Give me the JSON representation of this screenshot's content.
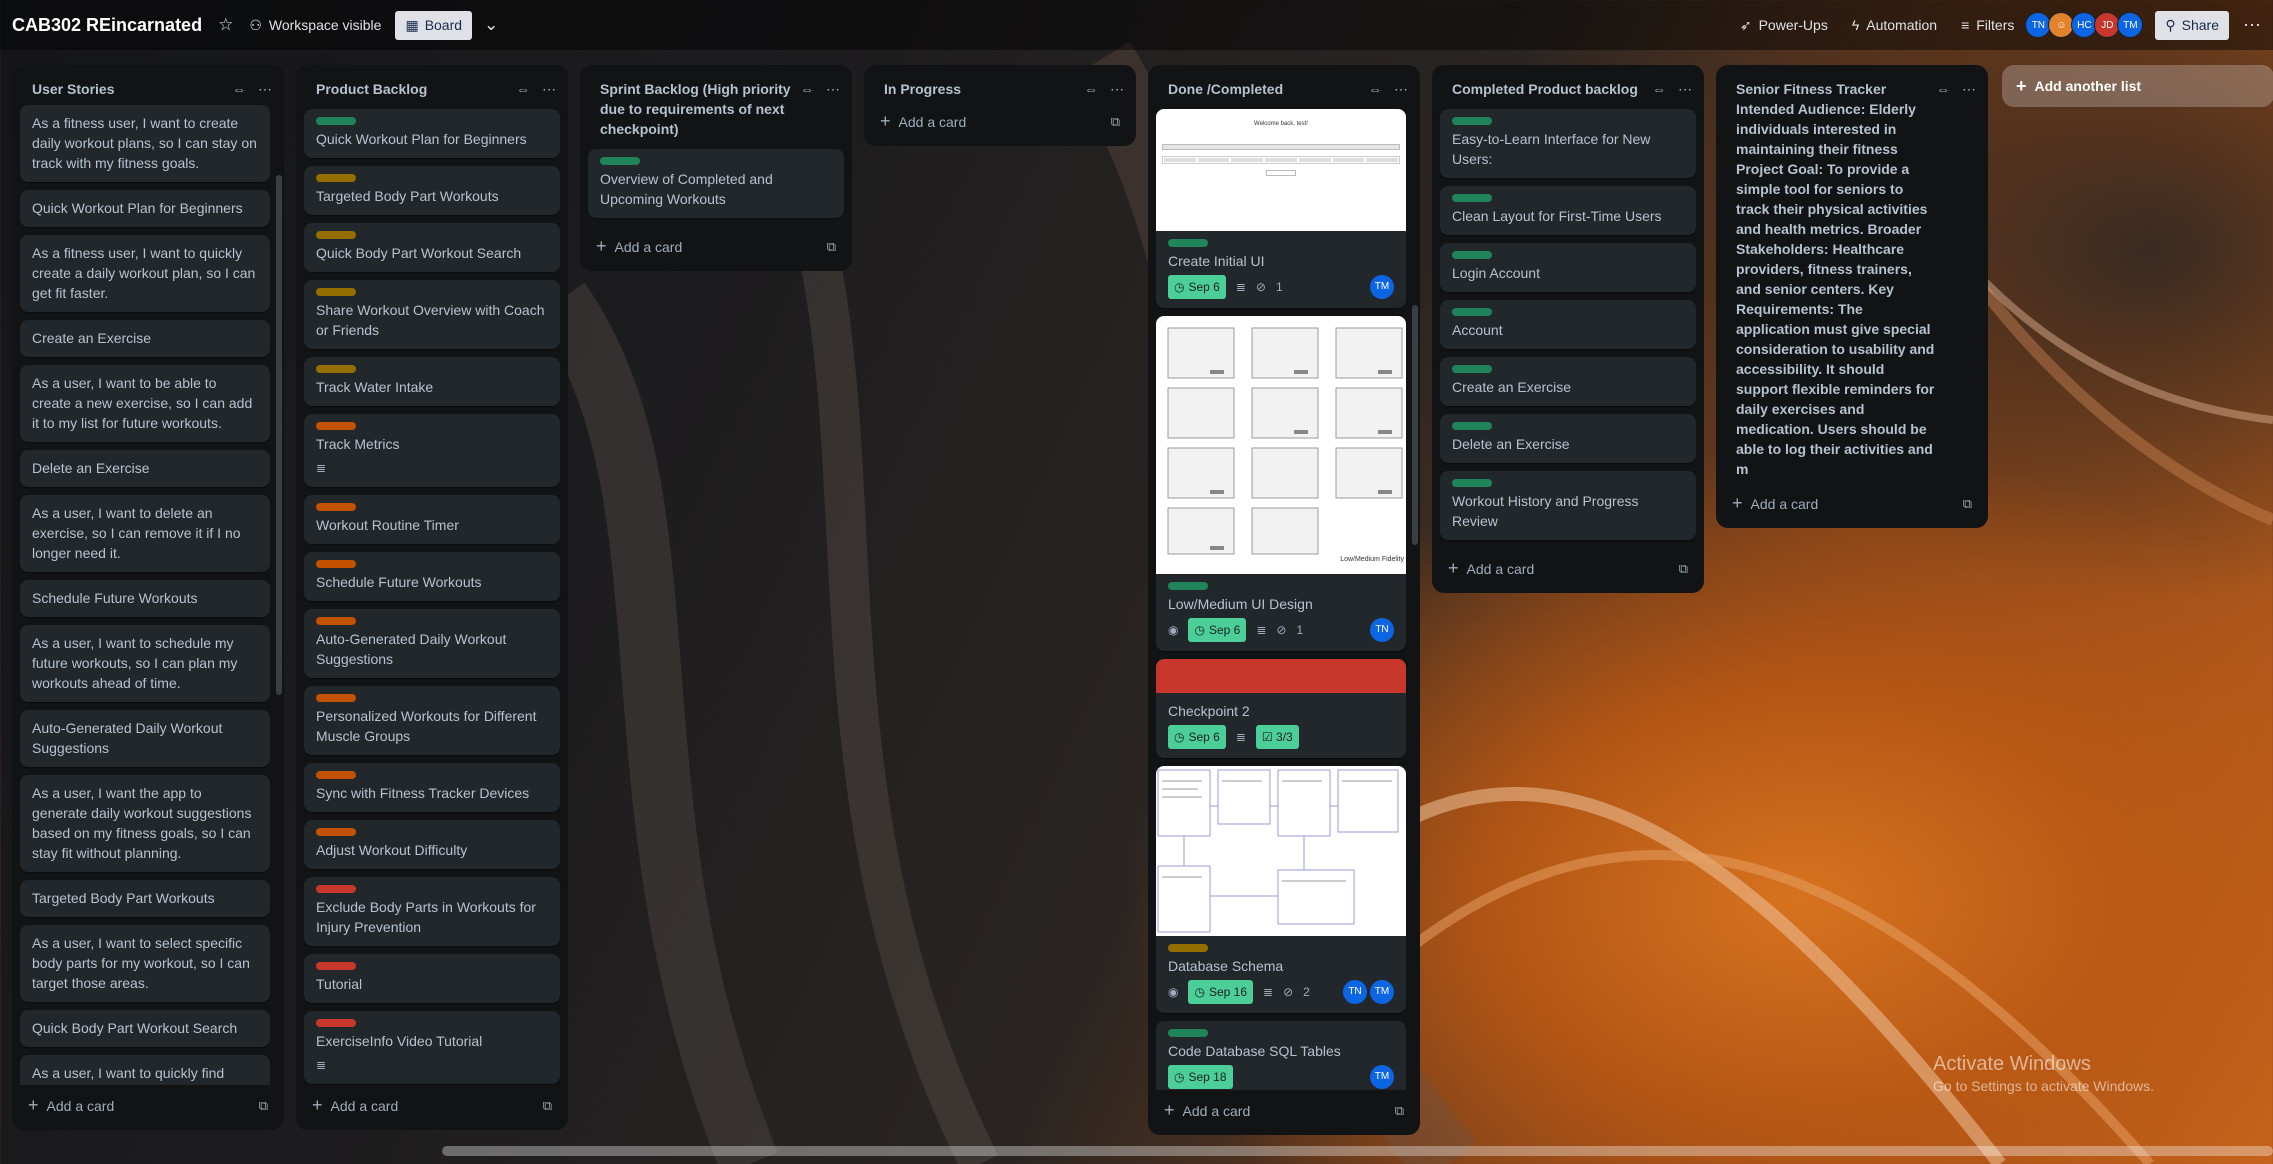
{
  "header": {
    "board_title": "CAB302 REincarnated",
    "visibility": "Workspace visible",
    "view": "Board",
    "power_ups": "Power-Ups",
    "automation": "Automation",
    "filters": "Filters",
    "share": "Share",
    "members": [
      {
        "initials": "TN",
        "color": "#0c66e4"
      },
      {
        "initials": "",
        "color": "#e2832b"
      },
      {
        "initials": "HC",
        "color": "#0c66e4"
      },
      {
        "initials": "JD",
        "color": "#c9372c"
      },
      {
        "initials": "TM",
        "color": "#0c66e4"
      }
    ]
  },
  "add_card_label": "Add a card",
  "add_list_label": "Add another list",
  "lists": {
    "user_stories": {
      "title": "User Stories",
      "cards": [
        "As a fitness user, I want to create daily workout plans, so I can stay on track with my fitness goals.",
        "Quick Workout Plan for Beginners",
        "As a fitness user, I want to quickly create a daily workout plan, so I can get fit faster.",
        "Create an Exercise",
        "As a user, I want to be able to create a new exercise, so I can add it to my list for future workouts.",
        "Delete an Exercise",
        "As a user, I want to delete an exercise, so I can remove it if I no longer need it.",
        "Schedule Future Workouts",
        "As a user, I want to schedule my future workouts, so I can plan my workouts ahead of time.",
        "Auto-Generated Daily Workout Suggestions",
        "As a user, I want the app to generate daily workout suggestions based on my fitness goals, so I can stay fit without planning.",
        "Targeted Body Part Workouts",
        "As a user, I want to select specific body parts for my workout, so I can target those areas.",
        "Quick Body Part Workout Search",
        "As a user, I want to quickly find workouts by body part, so I can"
      ]
    },
    "product_backlog": {
      "title": "Product Backlog",
      "cards": [
        {
          "label": "lg",
          "text": "Quick Workout Plan for Beginners"
        },
        {
          "label": "ly",
          "text": "Targeted Body Part Workouts"
        },
        {
          "label": "ly",
          "text": "Quick Body Part Workout Search"
        },
        {
          "label": "ly",
          "text": "Share Workout Overview with Coach or Friends"
        },
        {
          "label": "ly",
          "text": "Track Water Intake"
        },
        {
          "label": "lo",
          "text": "Track Metrics",
          "desc": true
        },
        {
          "label": "lo",
          "text": "Workout Routine Timer"
        },
        {
          "label": "lo",
          "text": "Schedule Future Workouts"
        },
        {
          "label": "lo",
          "text": "Auto-Generated Daily Workout Suggestions"
        },
        {
          "label": "lo",
          "text": "Personalized Workouts for Different Muscle Groups"
        },
        {
          "label": "lo",
          "text": "Sync with Fitness Tracker Devices"
        },
        {
          "label": "lo",
          "text": "Adjust Workout Difficulty"
        },
        {
          "label": "lr",
          "text": "Exclude Body Parts in Workouts for Injury Prevention"
        },
        {
          "label": "lr",
          "text": "Tutorial"
        },
        {
          "label": "lr",
          "text": "ExerciseInfo Video Tutorial",
          "desc": true
        }
      ]
    },
    "sprint_backlog": {
      "title": "Sprint Backlog (High priority due to requirements of next checkpoint)",
      "cards": [
        {
          "label": "lg",
          "text": "Overview of Completed and Upcoming Workouts"
        }
      ]
    },
    "in_progress": {
      "title": "In Progress"
    },
    "done": {
      "title": "Done /Completed",
      "cards": {
        "initial_ui": {
          "title": "Create Initial UI",
          "date": "Sep 6",
          "attachments": "1",
          "members": [
            "TM"
          ],
          "cover_text": "Welcome back, test!"
        },
        "low_medium": {
          "title": "Low/Medium UI Design",
          "date": "Sep 6",
          "attachments": "1",
          "members": [
            "TN"
          ],
          "cover_caption": "Low/Medium Fidelity"
        },
        "checkpoint": {
          "title": "Checkpoint 2",
          "date": "Sep 6",
          "checklist": "3/3"
        },
        "db_schema": {
          "title": "Database Schema",
          "date": "Sep 16",
          "attachments": "2",
          "members": [
            "TN",
            "TM"
          ]
        },
        "sql_tables": {
          "title": "Code Database SQL Tables",
          "date": "Sep 18",
          "members": [
            "TM"
          ]
        }
      }
    },
    "completed_backlog": {
      "title": "Completed Product backlog",
      "cards": [
        "Easy-to-Learn Interface for New Users:",
        "Clean Layout for First-Time Users",
        "Login Account",
        "Account",
        "Create an Exercise",
        "Delete an Exercise",
        "Workout History and Progress Review"
      ]
    },
    "senior": {
      "title": "Senior Fitness Tracker",
      "body": "Intended Audience: Elderly individuals interested in maintaining their fitness Project Goal: To provide a simple tool for seniors to track their physical activities and health metrics. Broader Stakeholders: Healthcare providers, fitness trainers, and senior centers. Key Requirements: The application must give special consideration to usability and accessibility. It should support flexible reminders for daily exercises and medication. Users should be able to log their activities and m"
    }
  },
  "watermark": {
    "title": "Activate Windows",
    "subtitle": "Go to Settings to activate Windows."
  }
}
